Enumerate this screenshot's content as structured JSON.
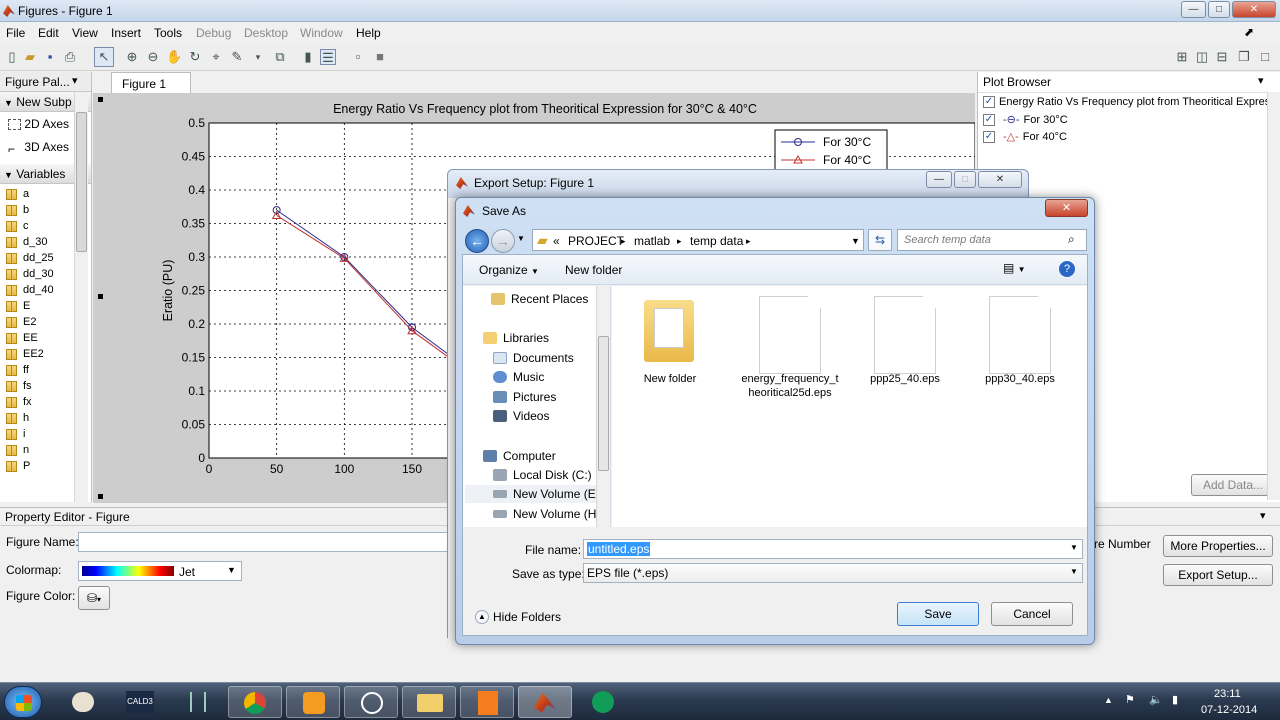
{
  "window": {
    "title": "Figures - Figure 1"
  },
  "menu": [
    "File",
    "Edit",
    "View",
    "Insert",
    "Tools",
    "Debug",
    "Desktop",
    "Window",
    "Help"
  ],
  "figure_palette": {
    "title": "Figure Pal...",
    "new_subplots": "New Subp",
    "axes_2d": "2D Axes",
    "axes_3d": "3D Axes",
    "variables_label": "Variables",
    "variables": [
      "a",
      "b",
      "c",
      "d_30",
      "dd_25",
      "dd_30",
      "dd_40",
      "E",
      "E2",
      "EE",
      "EE2",
      "ff",
      "fs",
      "fx",
      "h",
      "i",
      "n",
      "P"
    ]
  },
  "figure_tab": "Figure 1",
  "plot_browser": {
    "title": "Plot Browser",
    "items": [
      "Energy Ratio Vs Frequency plot from Theoritical Expressi",
      "For  30°C",
      "For  40°C"
    ],
    "add_data": "Add Data..."
  },
  "chart_data": {
    "type": "line",
    "title": "Energy Ratio Vs Frequency plot from Theoritical Expression for  30°C & 40°C",
    "ylabel": "Eratio (PU)",
    "xlabel": "",
    "xlim": [
      0,
      250
    ],
    "ylim": [
      0,
      0.5
    ],
    "x_ticks": [
      "0",
      "50",
      "100",
      "150"
    ],
    "y_ticks": [
      "0",
      "0.05",
      "0.1",
      "0.15",
      "0.2",
      "0.25",
      "0.3",
      "0.35",
      "0.4",
      "0.45",
      "0.5"
    ],
    "grid": true,
    "legend_position": "top-right",
    "series": [
      {
        "name": "For  30°C",
        "x": [
          50,
          100,
          150,
          180
        ],
        "y": [
          0.37,
          0.3,
          0.195,
          0.15
        ],
        "color": "#2b2b8c",
        "marker": "circle"
      },
      {
        "name": "For  40°C",
        "x": [
          50,
          100,
          150,
          180
        ],
        "y": [
          0.362,
          0.298,
          0.19,
          0.146
        ],
        "color": "#c03030",
        "marker": "triangle"
      }
    ]
  },
  "property_editor": {
    "title": "Property Editor - Figure",
    "figure_name_label": "Figure Name:",
    "colormap_label": "Colormap:",
    "colormap_value": "Jet",
    "figure_color_label": "Figure Color:",
    "partial_text": "re Number",
    "more_properties": "More Properties...",
    "export_setup": "Export Setup..."
  },
  "export_setup": {
    "title": "Export Setup: Figure 1"
  },
  "save_as": {
    "title": "Save As",
    "path": [
      "«",
      "PROJECT",
      "matlab",
      "temp data"
    ],
    "search_placeholder": "Search temp data",
    "organize": "Organize",
    "new_folder": "New folder",
    "nav": {
      "recent": "Recent Places",
      "libraries": "Libraries",
      "documents": "Documents",
      "music": "Music",
      "pictures": "Pictures",
      "videos": "Videos",
      "computer": "Computer",
      "local_disk": "Local Disk (C:)",
      "vol_e": "New Volume (E:)",
      "vol_h": "New Volume (H:)"
    },
    "files": [
      {
        "name": "New folder",
        "kind": "folder"
      },
      {
        "name": "energy_frequency_theoritical25d.eps",
        "kind": "file"
      },
      {
        "name": "ppp25_40.eps",
        "kind": "file"
      },
      {
        "name": "ppp30_40.eps",
        "kind": "file"
      }
    ],
    "file_name_label": "File name:",
    "file_name_value": "untitled.eps",
    "save_type_label": "Save as type:",
    "save_type_value": "EPS file (*.eps)",
    "hide_folders": "Hide Folders",
    "save": "Save",
    "cancel": "Cancel"
  },
  "taskbar": {
    "pinned": [
      "start",
      "paint",
      "cald3",
      "network",
      "chrome",
      "media",
      "whatsapp-like",
      "explorer",
      "pdf",
      "matlab",
      "hangouts"
    ],
    "time": "23:11",
    "date": "07-12-2014"
  },
  "colors": {
    "accent": "#3c7fd1",
    "selection": "#3399ff"
  }
}
